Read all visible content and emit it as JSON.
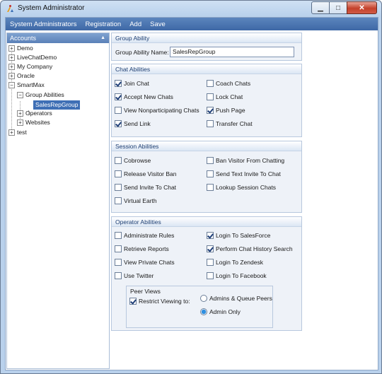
{
  "window": {
    "title": "System Administrator"
  },
  "menu": [
    "System Administrators",
    "Registration",
    "Add",
    "Save"
  ],
  "accounts": {
    "header": "Accounts",
    "nodes": [
      "Demo",
      "LiveChatDemo",
      "My Company",
      "Oracle",
      "SmartMax",
      "Group Abilities",
      "SalesRepGroup",
      "Operators",
      "Websites",
      "test"
    ]
  },
  "group_ability": {
    "header": "Group Ability",
    "name_label": "Group Ability Name:",
    "name_value": "SalesRepGroup"
  },
  "chat_abilities": {
    "header": "Chat Abilities",
    "items": [
      {
        "label": "Join Chat",
        "checked": true
      },
      {
        "label": "Coach Chats",
        "checked": false
      },
      {
        "label": "Accept New Chats",
        "checked": true
      },
      {
        "label": "Lock Chat",
        "checked": false
      },
      {
        "label": "View Nonparticipating Chats",
        "checked": false
      },
      {
        "label": "Push Page",
        "checked": true
      },
      {
        "label": "Send Link",
        "checked": true
      },
      {
        "label": "Transfer Chat",
        "checked": false
      }
    ]
  },
  "session_abilities": {
    "header": "Session Abilities",
    "items": [
      {
        "label": "Cobrowse",
        "checked": false
      },
      {
        "label": "Ban Visitor From Chatting",
        "checked": false
      },
      {
        "label": "Release Visitor Ban",
        "checked": false
      },
      {
        "label": "Send Text Invite To Chat",
        "checked": false
      },
      {
        "label": "Send Invite To Chat",
        "checked": false
      },
      {
        "label": "Lookup Session Chats",
        "checked": false
      },
      {
        "label": "Virtual Earth",
        "checked": false
      }
    ]
  },
  "operator_abilities": {
    "header": "Operator Abilities",
    "items": [
      {
        "label": "Administrate Rules",
        "checked": false
      },
      {
        "label": "Login To SalesForce",
        "checked": true
      },
      {
        "label": "Retrieve Reports",
        "checked": false
      },
      {
        "label": "Perform Chat History Search",
        "checked": true
      },
      {
        "label": "View Private Chats",
        "checked": false
      },
      {
        "label": "Login To Zendesk",
        "checked": false
      },
      {
        "label": "Use Twitter",
        "checked": false
      },
      {
        "label": "Login To Facebook",
        "checked": false
      }
    ],
    "peer_views": {
      "title": "Peer Views",
      "restrict_label": "Restrict Viewing to:",
      "restrict_checked": true,
      "options": [
        {
          "label": "Admins & Queue Peers",
          "selected": false
        },
        {
          "label": "Admin Only",
          "selected": true
        }
      ]
    }
  }
}
